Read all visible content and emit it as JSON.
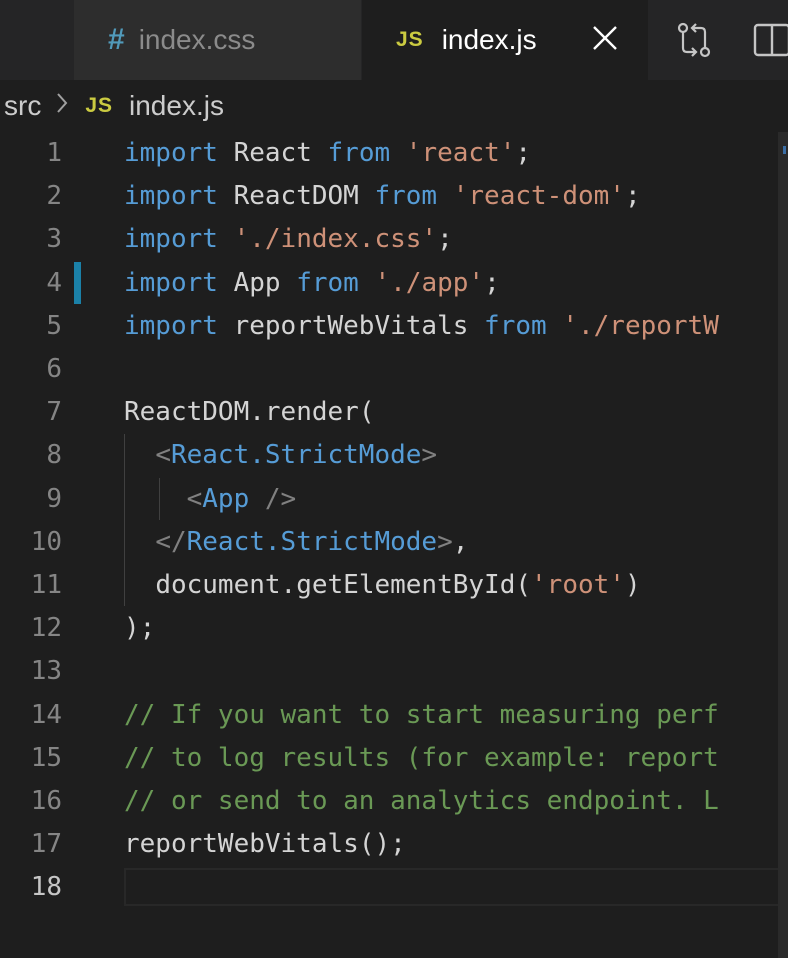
{
  "tabs": [
    {
      "label": "index.css",
      "icon": "#",
      "active": false
    },
    {
      "label": "index.js",
      "icon": "JS",
      "active": true
    }
  ],
  "breadcrumb": {
    "folder": "src",
    "file_icon": "JS",
    "file": "index.js"
  },
  "code_lines": [
    {
      "n": "1",
      "text": "import React from 'react';"
    },
    {
      "n": "2",
      "text": "import ReactDOM from 'react-dom';"
    },
    {
      "n": "3",
      "text": "import './index.css';"
    },
    {
      "n": "4",
      "text": "import App from './app';"
    },
    {
      "n": "5",
      "text": "import reportWebVitals from './reportW"
    },
    {
      "n": "6",
      "text": ""
    },
    {
      "n": "7",
      "text": "ReactDOM.render("
    },
    {
      "n": "8",
      "text": "  <React.StrictMode>"
    },
    {
      "n": "9",
      "text": "    <App />"
    },
    {
      "n": "10",
      "text": "  </React.StrictMode>,"
    },
    {
      "n": "11",
      "text": "  document.getElementById('root')"
    },
    {
      "n": "12",
      "text": ");"
    },
    {
      "n": "13",
      "text": ""
    },
    {
      "n": "14",
      "text": "// If you want to start measuring perf"
    },
    {
      "n": "15",
      "text": "// to log results (for example: report"
    },
    {
      "n": "16",
      "text": "// or send to an analytics endpoint. L"
    },
    {
      "n": "17",
      "text": "reportWebVitals();"
    },
    {
      "n": "18",
      "text": ""
    }
  ],
  "current_line": "18",
  "modified_line": "4",
  "colors": {
    "keyword": "#569cd6",
    "string": "#ce9178",
    "comment": "#6a9955",
    "js_icon": "#cbcb41",
    "css_icon": "#519aba",
    "modified_gutter": "#1b81a8"
  },
  "icons": {
    "close": "close-icon",
    "compare": "compare-changes-icon",
    "split": "split-editor-icon"
  }
}
